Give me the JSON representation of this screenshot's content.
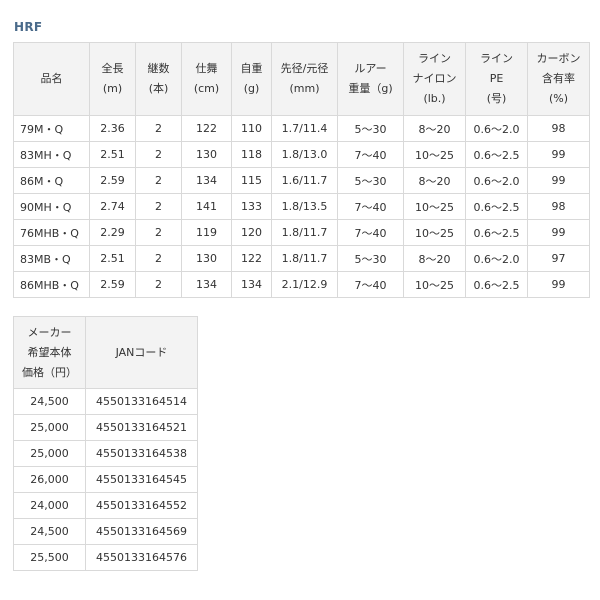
{
  "title": "HRF",
  "spec_table": {
    "headers": [
      [
        "品名"
      ],
      [
        "全長",
        "(m)"
      ],
      [
        "継数",
        "(本)"
      ],
      [
        "仕舞",
        "(cm)"
      ],
      [
        "自重",
        "(g)"
      ],
      [
        "先径/元径",
        "(mm)"
      ],
      [
        "ルアー",
        "重量（g)"
      ],
      [
        "ライン",
        "ナイロン",
        "(lb.)"
      ],
      [
        "ライン",
        "PE",
        "(号)"
      ],
      [
        "カーボン",
        "含有率",
        "(%)"
      ]
    ],
    "rows": [
      [
        "79M・Q",
        "2.36",
        "2",
        "122",
        "110",
        "1.7/11.4",
        "5〜30",
        "8〜20",
        "0.6〜2.0",
        "98"
      ],
      [
        "83MH・Q",
        "2.51",
        "2",
        "130",
        "118",
        "1.8/13.0",
        "7〜40",
        "10〜25",
        "0.6〜2.5",
        "99"
      ],
      [
        "86M・Q",
        "2.59",
        "2",
        "134",
        "115",
        "1.6/11.7",
        "5〜30",
        "8〜20",
        "0.6〜2.0",
        "99"
      ],
      [
        "90MH・Q",
        "2.74",
        "2",
        "141",
        "133",
        "1.8/13.5",
        "7〜40",
        "10〜25",
        "0.6〜2.5",
        "98"
      ],
      [
        "76MHB・Q",
        "2.29",
        "2",
        "119",
        "120",
        "1.8/11.7",
        "7〜40",
        "10〜25",
        "0.6〜2.5",
        "99"
      ],
      [
        "83MB・Q",
        "2.51",
        "2",
        "130",
        "122",
        "1.8/11.7",
        "5〜30",
        "8〜20",
        "0.6〜2.0",
        "97"
      ],
      [
        "86MHB・Q",
        "2.59",
        "2",
        "134",
        "134",
        "2.1/12.9",
        "7〜40",
        "10〜25",
        "0.6〜2.5",
        "99"
      ]
    ]
  },
  "price_table": {
    "headers": [
      [
        "メーカー",
        "希望本体",
        "価格（円）"
      ],
      [
        "JANコード"
      ]
    ],
    "rows": [
      [
        "24,500",
        "4550133164514"
      ],
      [
        "25,000",
        "4550133164521"
      ],
      [
        "25,000",
        "4550133164538"
      ],
      [
        "26,000",
        "4550133164545"
      ],
      [
        "24,000",
        "4550133164552"
      ],
      [
        "24,500",
        "4550133164569"
      ],
      [
        "25,500",
        "4550133164576"
      ]
    ]
  }
}
